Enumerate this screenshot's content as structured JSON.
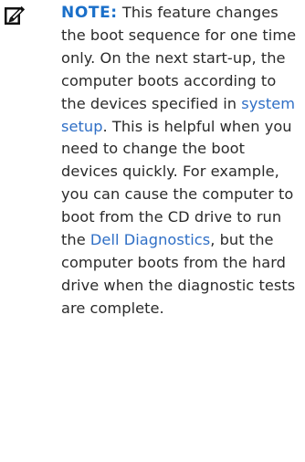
{
  "note": {
    "label": "NOTE:",
    "segments": {
      "text_1": " This feature changes the boot sequence for one time only. On the next start-up, the computer boots according to the devices specified in ",
      "link_1": "system setup",
      "text_2": ". This is helpful when you need to change the boot devices quickly. For example, you can cause the computer to boot from the CD drive to run the ",
      "link_2": "Dell Diagnostics",
      "text_3": ", but the computer boots from the hard drive when the diagnostic tests are complete."
    },
    "icon": "pencil-note-icon",
    "colors": {
      "label": "#1a6fc9",
      "link": "#2f6fc6",
      "text": "#2b2b2b",
      "icon": "#111111"
    }
  }
}
